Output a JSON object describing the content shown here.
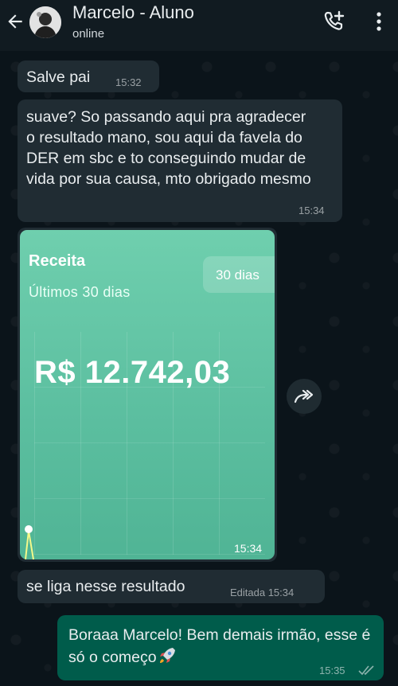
{
  "header": {
    "title": "Marcelo - Aluno",
    "status": "online"
  },
  "messages": [
    {
      "text": "Salve pai",
      "time": "15:32"
    },
    {
      "text": "suave? So passando aqui pra agradecer o resultado mano, sou aqui da favela do DER em sbc e to conseguindo mudar de vida por sua causa, mto obrigado mesmo",
      "time": "15:34"
    },
    {
      "card": {
        "title": "Receita",
        "subtitle": "Últimos 30 dias",
        "period": "30 dias",
        "value": "R$ 12.742,03"
      },
      "time": "15:34"
    },
    {
      "text": "se liga nesse resultado",
      "time": "Editada 15:34"
    },
    {
      "text": "Boraaa Marcelo! Bem demais irmão, esse é só o começo",
      "time": "15:35"
    }
  ],
  "colors": {
    "header_bg": "#111b21",
    "incoming_bubble": "#202c33",
    "outgoing_bubble": "#005c4b",
    "card_green": "#5cbfa0"
  },
  "icons": {
    "back": "arrow-left-icon",
    "call": "add-call-icon",
    "menu": "more-vert-icon",
    "forward": "forward-icon",
    "read": "double-check-icon",
    "emoji": "rocket-emoji"
  }
}
